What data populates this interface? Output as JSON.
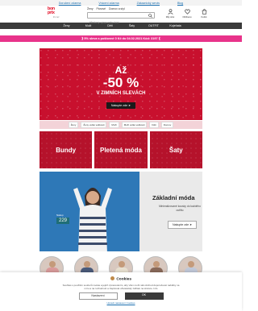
{
  "topbar": {
    "links": [
      "Doručení zdarma",
      "Vrácení zdarma",
      "Zákaznický servis",
      "Blog"
    ]
  },
  "header": {
    "logo_line1": "bon",
    "logo_line2": "prix",
    "logo_tagline": "it's me!",
    "categories": [
      "Ženy",
      "Pánové",
      "Domov a styl"
    ],
    "search_placeholder": "Hledaný výraz nebo kód",
    "icons": [
      {
        "name": "account-icon",
        "label": "Můj účet"
      },
      {
        "name": "wishlist-icon",
        "label": "Oblíbené"
      },
      {
        "name": "cart-icon",
        "label": "Košík"
      }
    ]
  },
  "nav": {
    "items": [
      "Ženy",
      "Muži",
      "Děti",
      "Šaty",
      "OUTFIT",
      "Kojeňata"
    ]
  },
  "promo": {
    "text": "⟫ 5% sleva s poštovné 0 Kč do 04.02.2021 Kód: 3197 ⟪"
  },
  "hero": {
    "line1": "Až",
    "line2": "-50 %",
    "line3": "V ZIMNÍCH SLEVÁCH",
    "button": "Nakupte zde ➤"
  },
  "subnav": {
    "items": [
      "Ženy",
      "Ženy velké velikosti",
      "Muži",
      "Muži velké velikosti",
      "Děti",
      "Domov"
    ]
  },
  "tiles": [
    {
      "label": "Bundy"
    },
    {
      "label": "Pletená móda"
    },
    {
      "label": "Šaty"
    }
  ],
  "basic": {
    "title": "Základní móda",
    "desc": "Minimalizované kousky do každého outfitu",
    "button": "Nakupte zde ➤",
    "price_prefix": "Nákup",
    "price": "229"
  },
  "cookie": {
    "title": "Cookies",
    "text": "Souhlas s použitím souborů cookie a jejich zpracováním, aby Vám mohl náš obchod doporučovat nabídky na míru a na rozhodnutí a zlepšovat uživatelský zážitek na stránce. Info",
    "decline": "Nastavení",
    "accept": "OK",
    "settings_link": "Upravit nastavení Cookies"
  },
  "colors": {
    "accent_red": "#c8102e",
    "promo_pink": "#e8338a",
    "nav_dark": "#3a3a3a"
  }
}
